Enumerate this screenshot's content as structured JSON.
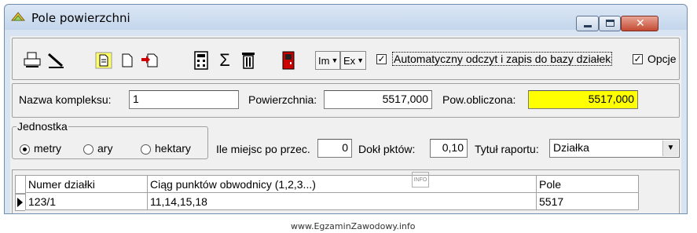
{
  "window": {
    "title": "Pole powierzchni"
  },
  "toolbar": {
    "import_dropdown": "Im",
    "export_dropdown": "Ex",
    "auto_checkbox": {
      "checked": true,
      "label": "Automatyczny odczyt i zapis do bazy działek"
    },
    "options_checkbox": {
      "checked": true,
      "label": "Opcje"
    },
    "sum_symbol": "Σ"
  },
  "complex": {
    "name_label": "Nazwa kompleksu:",
    "name_value": "1",
    "area_label": "Powierzchnia:",
    "area_value": "5517,000",
    "calc_label": "Pow.obliczona:",
    "calc_value": "5517,000",
    "calc_highlight": "#ffff00"
  },
  "units": {
    "group_title": "Jednostka",
    "options": [
      {
        "label": "metry",
        "selected": true
      },
      {
        "label": "ary",
        "selected": false
      },
      {
        "label": "hektary",
        "selected": false
      }
    ]
  },
  "settings": {
    "decimals_label": "Ile miejsc po przec.",
    "decimals_value": "0",
    "precision_label": "Dokł pktów:",
    "precision_value": "0,10",
    "report_title_label": "Tytuł raportu:",
    "report_title_value": "Działka"
  },
  "grid": {
    "columns": [
      "Numer działki",
      "Ciąg punktów obwodnicy (1,2,3...)",
      "Pole"
    ],
    "rows": [
      [
        "123/1",
        "11,14,15,18",
        "5517"
      ]
    ],
    "watermark_icon_text": "INFO"
  },
  "footer": {
    "text": "www.EgzaminZawodowy.info"
  }
}
